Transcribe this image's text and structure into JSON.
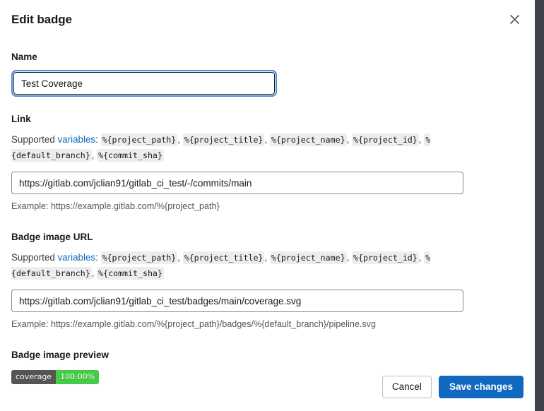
{
  "modal": {
    "title": "Edit badge",
    "close_icon": "close-icon"
  },
  "fields": {
    "name": {
      "label": "Name",
      "value": "Test Coverage",
      "placeholder": ""
    },
    "link": {
      "label": "Link",
      "supported_prefix": "Supported ",
      "supported_link": "variables",
      "supported_colon": ": ",
      "variables": [
        "%{project_path}",
        "%{project_title}",
        "%{project_name}",
        "%{project_id}",
        "%{default_branch}",
        "%{commit_sha}"
      ],
      "value": "https://gitlab.com/jclian91/gitlab_ci_test/-/commits/main",
      "placeholder": "",
      "example": "Example: https://example.gitlab.com/%{project_path}"
    },
    "badge_image_url": {
      "label": "Badge image URL",
      "supported_prefix": "Supported ",
      "supported_link": "variables",
      "supported_colon": ": ",
      "variables": [
        "%{project_path}",
        "%{project_title}",
        "%{project_name}",
        "%{project_id}",
        "%{default_branch}",
        "%{commit_sha}"
      ],
      "value": "https://gitlab.com/jclian91/gitlab_ci_test/badges/main/coverage.svg",
      "placeholder": "",
      "example": "Example: https://example.gitlab.com/%{project_path}/badges/%{default_branch}/pipeline.svg"
    },
    "preview": {
      "label": "Badge image preview",
      "badge_label": "coverage",
      "badge_value": "100.00%",
      "badge_label_color": "#555555",
      "badge_value_color": "#44cc44"
    }
  },
  "footer": {
    "cancel_label": "Cancel",
    "save_label": "Save changes"
  },
  "colors": {
    "accent": "#1068bf",
    "link": "#1068bf",
    "focus_ring": "#428fdc",
    "page_background": "#3f4246"
  }
}
